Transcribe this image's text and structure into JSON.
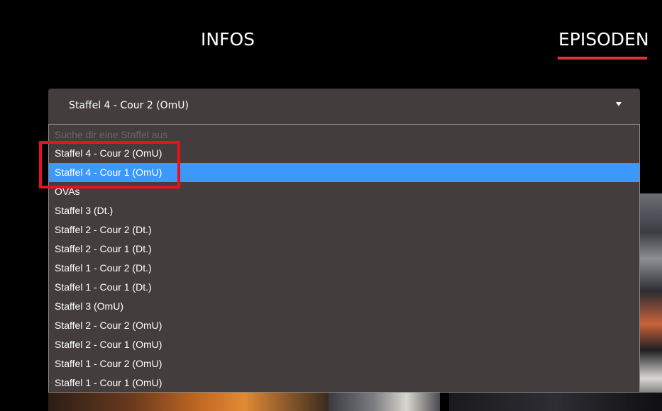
{
  "tabs": {
    "infos_label": "INFOS",
    "episoden_label": "EPISODEN",
    "active": "EPISODEN",
    "accent_color": "#e2313a"
  },
  "season_select": {
    "selected_value": "Staffel 4 - Cour 2 (OmU)",
    "search_placeholder": "Suche dir eine Staffel aus",
    "highlight_color": "#3b99fc",
    "options": [
      {
        "label": "Staffel 4 - Cour 2 (OmU)"
      },
      {
        "label": "Staffel 4 - Cour 1 (OmU)"
      },
      {
        "label": "OVAs"
      },
      {
        "label": "Staffel 3 (Dt.)"
      },
      {
        "label": "Staffel 2 - Cour 2 (Dt.)"
      },
      {
        "label": "Staffel 2 - Cour 1 (Dt.)"
      },
      {
        "label": "Staffel 1 - Cour 2 (Dt.)"
      },
      {
        "label": "Staffel 1 - Cour 1 (Dt.)"
      },
      {
        "label": "Staffel 3 (OmU)"
      },
      {
        "label": "Staffel 2 - Cour 2 (OmU)"
      },
      {
        "label": "Staffel 2 - Cour 1 (OmU)"
      },
      {
        "label": "Staffel 1 - Cour 2 (OmU)"
      },
      {
        "label": "Staffel 1 - Cour 1 (OmU)"
      }
    ],
    "highlighted_option": "Staffel 4 - Cour 1 (OmU)"
  },
  "annotation": {
    "color": "#e8121c"
  }
}
